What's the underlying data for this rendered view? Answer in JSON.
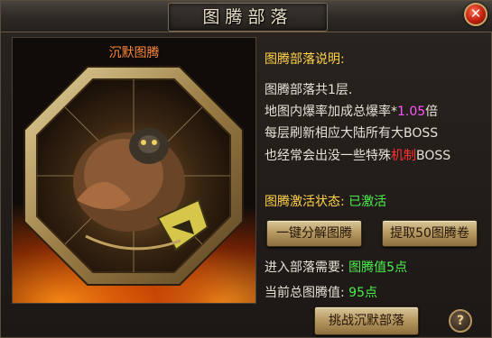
{
  "window": {
    "title": "图腾部落"
  },
  "portrait": {
    "label": "沉默图腾"
  },
  "info": {
    "header": "图腾部落说明:",
    "line1": "图腾部落共1层.",
    "line2_prefix": "地图内爆率加成总爆率*",
    "line2_value": "1.05",
    "line2_suffix": "倍",
    "line3": "每层刷新相应大陆所有大BOSS",
    "line4_prefix": "也经常会出没一些特殊",
    "line4_highlight": "机制",
    "line4_suffix": "BOSS",
    "status_label": "图腾激活状态:",
    "status_value": "已激活",
    "req_label": "进入部落需要:",
    "req_value": "图腾值5点",
    "current_label": "当前总图腾值:",
    "current_value": "95点"
  },
  "buttons": {
    "decompose": "一键分解图腾",
    "extract": "提取50图腾卷",
    "challenge": "挑战沉默部落",
    "help": "?",
    "close": "✕"
  },
  "colors": {
    "header": "#ffd24a",
    "highlight_magenta": "#ff55ff",
    "highlight_red": "#ff3030",
    "status_green": "#4cf04c",
    "portrait_label": "#ff8a3d"
  }
}
